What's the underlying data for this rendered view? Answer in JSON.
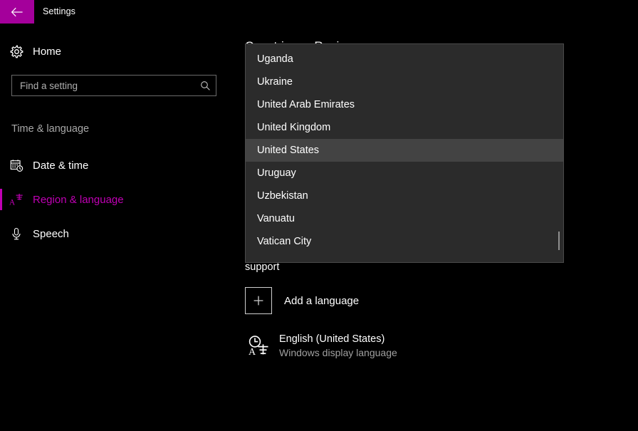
{
  "window": {
    "title": "Settings",
    "back_icon": "back-arrow-icon",
    "accent_color": "#A4009B"
  },
  "sidebar": {
    "home": {
      "label": "Home",
      "icon": "gear-icon"
    },
    "search": {
      "placeholder": "Find a setting",
      "value": "",
      "icon": "search-icon"
    },
    "section_label": "Time & language",
    "items": [
      {
        "label": "Date & time",
        "icon": "calendar-clock-icon",
        "selected": false
      },
      {
        "label": "Region & language",
        "icon": "language-icon",
        "selected": true
      },
      {
        "label": "Speech",
        "icon": "microphone-icon",
        "selected": false
      }
    ],
    "selected_color": "#C000B4"
  },
  "main": {
    "heading": "Countries or Regions",
    "subtext": "support",
    "add_language": {
      "label": "Add a language",
      "icon": "plus-icon"
    },
    "languages": [
      {
        "name": "English (United States)",
        "sub": "Windows display language",
        "icon": "language-character-icon"
      }
    ]
  },
  "dropdown": {
    "name": "country-or-region-dropdown",
    "selected_value": "United States",
    "selected_index": 4,
    "background_color": "#2b2b2b",
    "highlight_color": "#434343",
    "options": [
      "Uganda",
      "Ukraine",
      "United Arab Emirates",
      "United Kingdom",
      "United States",
      "Uruguay",
      "Uzbekistan",
      "Vanuatu",
      "Vatican City"
    ],
    "scrollbar": {
      "thumb_position_pct": 87
    }
  }
}
